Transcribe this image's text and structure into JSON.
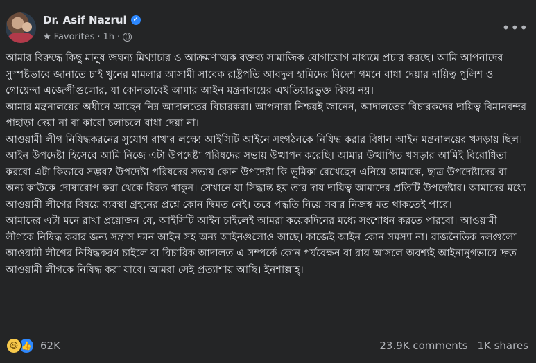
{
  "author": {
    "name": "Dr. Asif Nazrul",
    "audience": "Favorites",
    "separator": "·",
    "time": "1h",
    "time_separator": "·"
  },
  "post": {
    "paragraphs": [
      "আমার বিরুদ্ধে কিছু মানুষ জঘন্য মিথ্যাচার ও আক্রমণাত্মক বক্তব্য সামাজিক যোগাযোগ মাধ্যমে প্রচার করছে। আমি আপনাদের সুস্পষ্টভাবে জানাতে চাই খুনের মামলার আসামী সাবেক রাষ্ট্রপতি আবদুল হামিদের বিদেশ গমনে বাধা দেয়ার দায়িত্ব পুলিশ ও গোয়েন্দা এজেন্সীগুলোর, যা কোনভাবেই আমার আইন মন্ত্রনালয়ের এখতিয়ারভুক্ত বিষয় নয়।",
      "আমার মন্ত্রনালয়ের অধীনে আছেন নিম্ন আদালতের বিচারকরা। আপনারা নিশ্চয়ই জানেন, আদালতের বিচারকদের দায়িত্ব বিমানবন্দর পাহাড়া দেয়া না বা কারো চলাচলে বাধা দেয়া না।",
      "আওয়ামী লীগ নিষিদ্ধকরনের সুযোগ রাখার লক্ষ্যে আইসিটি আইনে সংগঠনকে নিষিদ্ধ করার বিধান আইন মন্ত্রনালয়ের খসড়ায় ছিল। আইন উপদেষ্টা হিসেবে আমি নিজে এটা উপদেষ্টা পরিষদের সভায় উত্থাপন করেছি। আমার উত্থাপিত খসড়ার আমিই বিরোধিতা করবো এটা কিভাবে সম্ভব? উপদেষ্টা পরিষদের সভায় কোন উপদেষ্টা কি ভূমিকা রেখেছেন এনিয়ে আমাকে, ছাত্র উপদেষ্টাদের বা অন্য কাউকে দোষারোপ করা থেকে বিরত থাকুন। সেখানে যা সিদ্ধান্ত হয় তার দায় দায়িত্ব আমাদের প্রতিটি উপদেষ্টার। আমাদের মধ্যে আওয়ামী লীগের বিষয়ে ব্যবস্থা গ্রহনের প্রশ্নে কোন দ্বিমত নেই। তবে পদ্ধতি নিয়ে সবার নিজস্ব মত থাকতেই পারে।",
      "আমাদের এটা মনে রাখা প্রয়োজন যে, আইসিটি আইন চাইলেই আমরা কয়েকদিনের মধ্যে সংশোধন করতে পারবো। আওয়ামী লীগকে নিষিদ্ধ করার জন্য সন্ত্রাস দমন আইন সহ অন্য আইনগুলোও আছে। কাজেই আইন কোন সমস্যা না।  রাজনৈতিক দলগুলো আওয়ামী লীগের নিষিদ্ধকরণ চাইলে বা বিচারিক আদালত এ সম্পর্কে কোন পর্যবেক্ষন বা রায় আসলে অবশ্যই আইনানুগভাবে দ্রুত আওয়ামী লীগকে নিষিদ্ধ করা যাবে। আমরা সেই প্রত্যাশায় আছি। ইনশাল্লাহ্।"
    ]
  },
  "footer": {
    "reaction_count": "62K",
    "comments": "23.9K comments",
    "shares": "1K shares"
  },
  "icons": {
    "verified": "verified-badge-icon",
    "audience": "star-icon",
    "privacy": "globe-icon",
    "more": "more-horizontal-icon",
    "reactions": [
      "haha-icon",
      "like-icon"
    ]
  },
  "colors": {
    "background": "#242526",
    "text": "#e4e6eb",
    "secondary_text": "#b0b3b8",
    "accent": "#2d88ff"
  }
}
